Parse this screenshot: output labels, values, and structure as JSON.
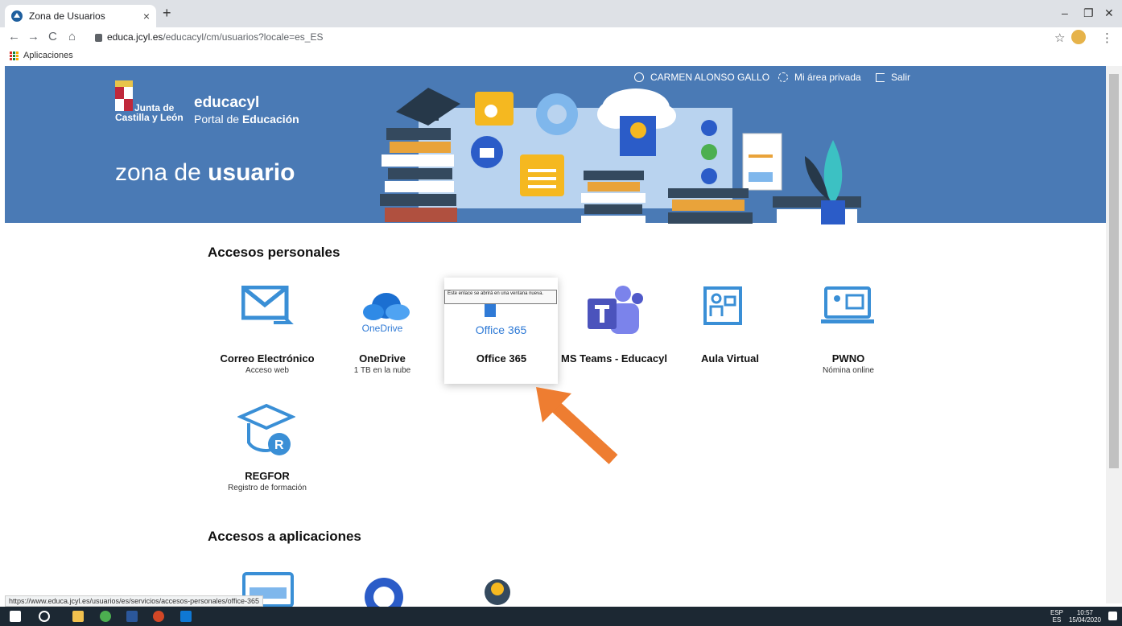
{
  "browser": {
    "tab_title": "Zona de Usuarios",
    "tab_close": "×",
    "new_tab": "+",
    "url_host": "educa.jcyl.es",
    "url_path": "/educacyl/cm/usuarios?locale=es_ES",
    "bookmark_apps": "Aplicaciones",
    "win_min": "–",
    "win_max": "❐",
    "win_close": "✕",
    "back": "←",
    "forward": "→",
    "reload": "C",
    "home": "⌂",
    "star": "☆",
    "menu": "⋮"
  },
  "header": {
    "brand_line1": "Junta de",
    "brand_line2": "Castilla y León",
    "site_name": "educacyl",
    "portal_prefix": "Portal de ",
    "portal_bold": "Educación",
    "zona_prefix": "zona de ",
    "zona_bold": "usuario",
    "user_name": "CARMEN ALONSO GALLO",
    "private_area": "Mi área privada",
    "logout": "Salir"
  },
  "personal": {
    "heading": "Accesos personales",
    "items": [
      {
        "title": "Correo Electrónico",
        "subtitle": "Acceso web"
      },
      {
        "title": "OneDrive",
        "subtitle": "1 TB en la nube",
        "logo_text": "OneDrive"
      },
      {
        "title": "Office 365",
        "subtitle": "",
        "logo_text": "Office 365"
      },
      {
        "title": "MS Teams - Educacyl",
        "subtitle": ""
      },
      {
        "title": "Aula Virtual",
        "subtitle": ""
      },
      {
        "title": "PWNO",
        "subtitle": "Nómina online"
      },
      {
        "title": "REGFOR",
        "subtitle": "Registro de formación"
      }
    ]
  },
  "tooltip": "Este enlace se abrirá en una ventana nueva.",
  "apps": {
    "heading": "Accesos a aplicaciones"
  },
  "status_url": "https://www.educa.jcyl.es/usuarios/es/servicios/accesos-personales/office-365",
  "taskbar": {
    "lang1": "ESP",
    "lang2": "ES",
    "time": "10:57",
    "date": "15/04/2020"
  },
  "colors": {
    "banner": "#4a7ab5",
    "accent_blue": "#2f7ad6",
    "arrow": "#ee7d31",
    "teams": "#4b53bc"
  }
}
